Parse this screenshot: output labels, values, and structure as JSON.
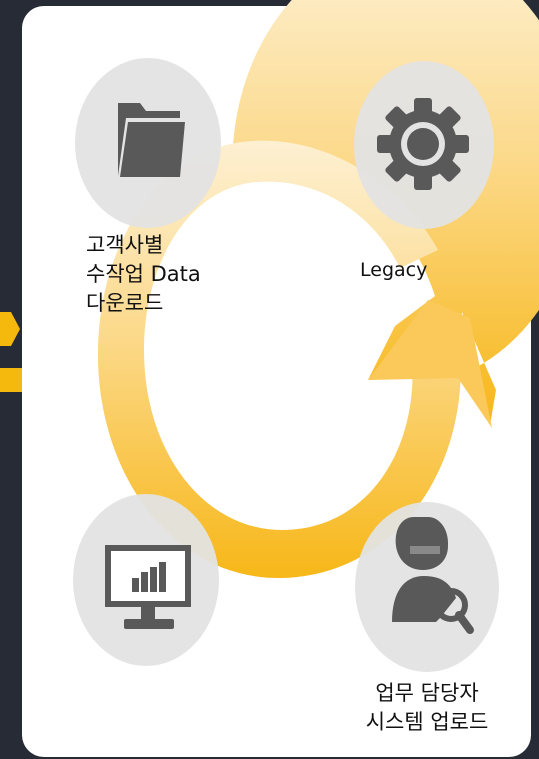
{
  "nodes": {
    "download": {
      "label_lines": [
        "고객사별",
        "수작업 Data",
        "다운로드"
      ]
    },
    "legacy": {
      "label": "Legacy"
    },
    "upload": {
      "label_lines": [
        "업무 담당자",
        "시스템 업로드"
      ]
    }
  },
  "icons": {
    "folder": "folder-icon",
    "gear": "gear-icon",
    "monitor": "monitor-chart-icon",
    "user": "user-search-icon"
  },
  "colors": {
    "background": "#262b35",
    "panel": "#ffffff",
    "accent": "#f5b80d",
    "circle": "#e3e3e3",
    "icon": "#595959"
  }
}
